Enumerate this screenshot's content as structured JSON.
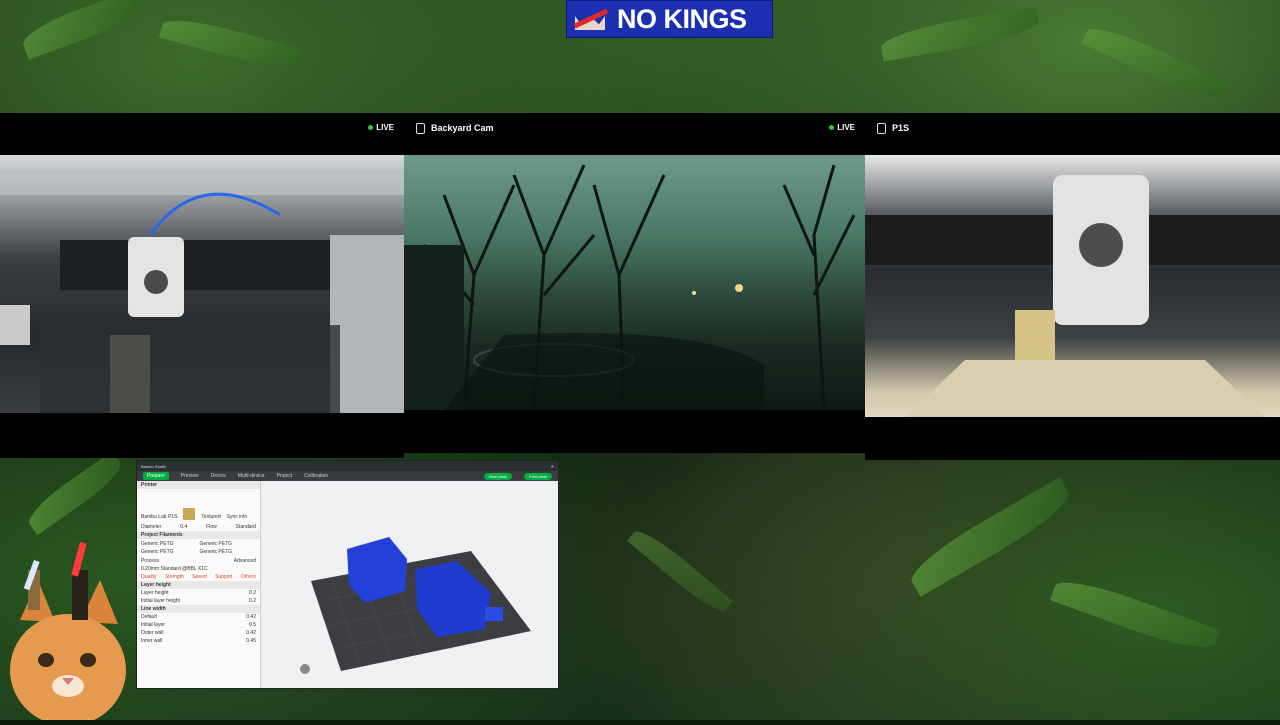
{
  "logo": {
    "text": "NO KINGS"
  },
  "cams": [
    {
      "title": "",
      "live": "LIVE"
    },
    {
      "title": "Backyard Cam",
      "live": "LIVE"
    },
    {
      "title": "P1S",
      "live": ""
    }
  ],
  "slicer": {
    "title": "Bambu Studio",
    "tabs": [
      "Prepare",
      "Preview",
      "Device",
      "Multi-device",
      "Project",
      "Calibration"
    ],
    "buttons": {
      "slice": "Slice plate",
      "print": "Print plate"
    },
    "printer": {
      "label": "Printer",
      "name": "Bambu Lab P1S",
      "plate": "Textured",
      "sync": "Sync info"
    },
    "nozzle": {
      "diameter_label": "Diameter",
      "diameter": "0.4",
      "flow_label": "Flow",
      "flow": "Standard"
    },
    "filaments": {
      "label": "Project Filaments",
      "items": [
        "Generic PETG",
        "Generic PETG",
        "Generic PETG",
        "Generic PETG"
      ]
    },
    "process": {
      "label": "Process",
      "profile": "0.20mm Standard @BBL X1C",
      "advanced": "Advanced"
    },
    "subtabs": [
      "Quality",
      "Strength",
      "Speed",
      "Support",
      "Others"
    ],
    "layer_height": {
      "label": "Layer height",
      "rows": [
        [
          "Layer height",
          "0.2"
        ],
        [
          "Initial layer height",
          "0.2"
        ]
      ]
    },
    "line_width": {
      "label": "Line width",
      "rows": [
        [
          "Default",
          "0.42"
        ],
        [
          "Initial layer",
          "0.5"
        ],
        [
          "Outer wall",
          "0.42"
        ],
        [
          "Inner wall",
          "0.45"
        ]
      ]
    }
  }
}
